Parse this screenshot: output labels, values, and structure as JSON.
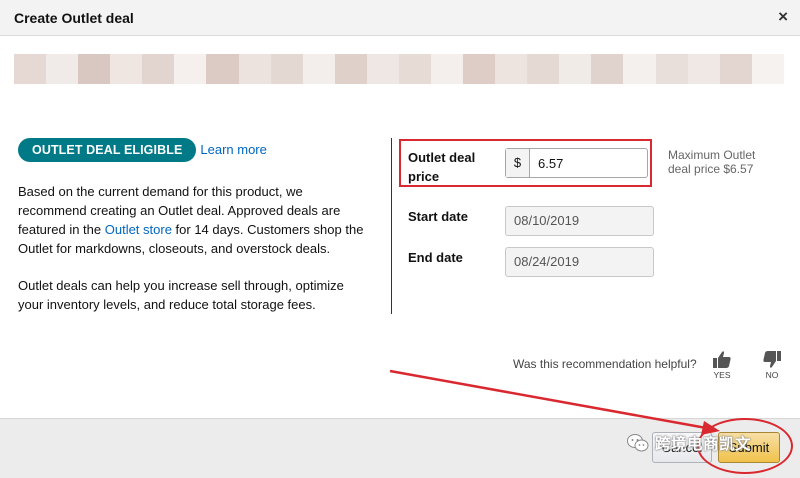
{
  "dialog": {
    "title": "Create Outlet deal",
    "close_glyph": "×"
  },
  "left": {
    "badge": "OUTLET DEAL ELIGIBLE",
    "learn_more": "Learn more",
    "p1_part1": "Based on the current demand for this product, we recommend creating an Outlet deal. Approved deals are featured in the ",
    "p1_link": "Outlet store",
    "p1_part2": " for 14 days. Customers shop the Outlet for markdowns, closeouts, and overstock deals.",
    "p2": "Outlet deals can help you increase sell through, optimize your inventory levels, and reduce total storage fees."
  },
  "form": {
    "price_label_line1": "Outlet deal",
    "price_label_line2": "price",
    "currency": "$",
    "price_value": "6.57",
    "max_note_line1": "Maximum Outlet",
    "max_note_line2": "deal price $6.57",
    "start_label": "Start date",
    "start_value": "08/10/2019",
    "end_label": "End date",
    "end_value": "08/24/2019"
  },
  "feedback": {
    "question": "Was this recommendation helpful?",
    "yes": "YES",
    "no": "NO"
  },
  "footer": {
    "cancel": "Cancel",
    "submit": "Submit"
  },
  "watermark": {
    "text": "跨境电商凯文"
  },
  "colors": {
    "badge": "#007a87",
    "link": "#0066c0",
    "annotation_red": "#d9282f",
    "submit_yellow": "#f0c14b"
  }
}
